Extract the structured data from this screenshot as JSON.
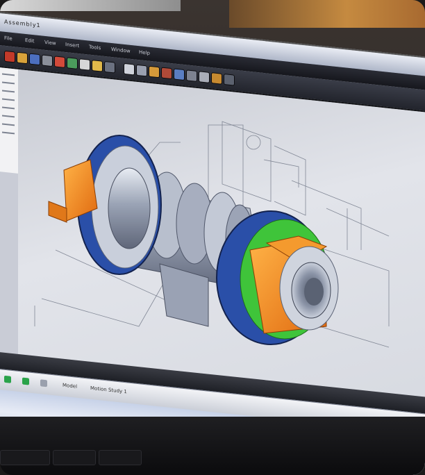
{
  "window": {
    "title": "Assembly1"
  },
  "menus": [
    "File",
    "Edit",
    "View",
    "Insert",
    "Tools",
    "Window",
    "Help"
  ],
  "toolbar": {
    "icons": [
      "new-icon",
      "open-icon",
      "save-icon",
      "print-icon",
      "undo-icon",
      "redo-icon",
      "select-icon",
      "rebuild-icon",
      "options-icon",
      "zoom-icon",
      "rotate-icon",
      "pan-icon",
      "section-icon",
      "view-orientation-icon",
      "display-style-icon",
      "hide-show-icon",
      "appearance-icon",
      "scene-icon"
    ]
  },
  "tabs": {
    "labels": [
      "Model",
      "Motion Study 1"
    ]
  },
  "model": {
    "name": "flanged-coupling-assembly",
    "colors": {
      "flange_blue": "#2a4fa8",
      "block_orange": "#f08a1c",
      "face_green": "#3fc43a",
      "body_steel": "#aeb6c6"
    }
  }
}
